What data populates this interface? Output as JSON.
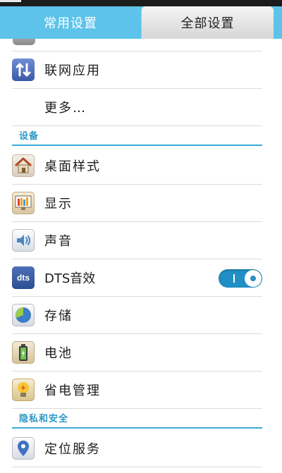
{
  "tabs": {
    "common": "常用设置",
    "all": "全部设置"
  },
  "rows_top": [
    {
      "label": "联网应用",
      "icon": "network-apps-icon"
    },
    {
      "label": "更多…"
    }
  ],
  "sections": {
    "device": "设备",
    "privacy": "隐私和安全"
  },
  "device_rows": [
    {
      "label": "桌面样式",
      "icon": "home-icon"
    },
    {
      "label": "显示",
      "icon": "display-icon"
    },
    {
      "label": "声音",
      "icon": "speaker-icon"
    },
    {
      "label": "DTS音效",
      "icon": "dts-icon",
      "icon_text": "dts",
      "toggle_on": true
    },
    {
      "label": "存储",
      "icon": "storage-pie-icon"
    },
    {
      "label": "电池",
      "icon": "battery-icon"
    },
    {
      "label": "省电管理",
      "icon": "lightbulb-icon"
    }
  ],
  "privacy_rows": [
    {
      "label": "定位服务",
      "icon": "location-pin-icon"
    }
  ]
}
